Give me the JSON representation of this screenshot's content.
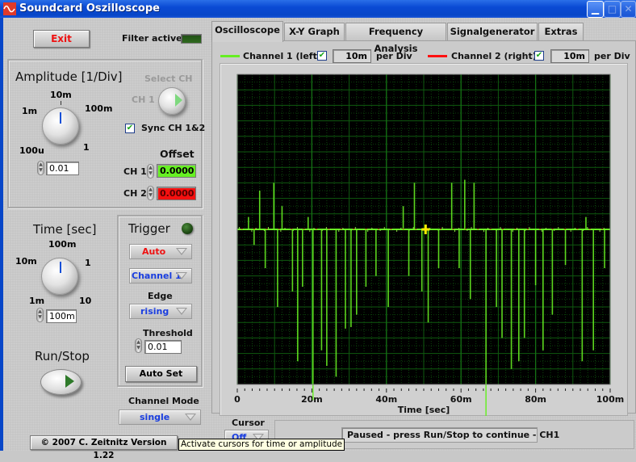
{
  "window": {
    "title": "Soundcard Oszilloscope",
    "controls": [
      "minimize",
      "maximize",
      "close"
    ]
  },
  "left_panel": {
    "exit_label": "Exit",
    "filter_label": "Filter active",
    "amplitude": {
      "title": "Amplitude [1/Div]",
      "ticks": [
        "100u",
        "1m",
        "10m",
        "100m",
        "1"
      ],
      "value": "0.01"
    },
    "select_ch": {
      "title": "Select CH",
      "value": "CH 1"
    },
    "sync_label": "Sync CH 1&2",
    "sync_checked": true,
    "offset": {
      "title": "Offset",
      "ch1_label": "CH 1",
      "ch1_value": "0.0000",
      "ch1_color": "#5cf02a",
      "ch2_label": "CH 2",
      "ch2_value": "0.0000",
      "ch2_color": "#f01010"
    },
    "time": {
      "title": "Time [sec]",
      "ticks": [
        "1m",
        "10m",
        "100m",
        "1",
        "10"
      ],
      "value": "100m"
    },
    "trigger": {
      "title": "Trigger",
      "mode": "Auto",
      "source": "Channel 1",
      "edge_label": "Edge",
      "edge": "rising",
      "threshold_label": "Threshold",
      "threshold_value": "0.01",
      "autoset_label": "Auto Set"
    },
    "run_stop_label": "Run/Stop",
    "channel_mode_label": "Channel Mode",
    "channel_mode": "single",
    "copyright": "© 2007   C. Zeitnitz Version 1.22"
  },
  "tabs": [
    {
      "label": "Oscilloscope",
      "active": true
    },
    {
      "label": "X-Y Graph",
      "active": false
    },
    {
      "label": "Frequency Analysis",
      "active": false
    },
    {
      "label": "Signalgenerator",
      "active": false
    },
    {
      "label": "Extras",
      "active": false
    }
  ],
  "channels": {
    "ch1_label": "Channel 1 (left)",
    "ch1_enabled": true,
    "ch1_per_div": "10m",
    "ch1_color": "#66ee22",
    "ch2_label": "Channel 2 (right)",
    "ch2_enabled": true,
    "ch2_per_div": "10m",
    "ch2_color": "#ff1010",
    "per_div_label": "per Div"
  },
  "cursor": {
    "label": "Cursor",
    "value": "Off"
  },
  "status": "Paused - press Run/Stop to continue - CH1",
  "tooltip": "Activate cursors for time or amplitude",
  "chart_data": {
    "type": "line",
    "title": "",
    "xlabel": "Time [sec]",
    "ylabel": "",
    "xlim": [
      0,
      0.1
    ],
    "ylim": [
      -0.1,
      0.1
    ],
    "xticks": [
      {
        "value": 0,
        "label": "0"
      },
      {
        "value": 0.02,
        "label": "20m"
      },
      {
        "value": 0.04,
        "label": "40m"
      },
      {
        "value": 0.06,
        "label": "60m"
      },
      {
        "value": 0.08,
        "label": "80m"
      },
      {
        "value": 0.1,
        "label": "100m"
      }
    ],
    "grid": true,
    "background": "#000000",
    "grid_color": "#0f5a0f",
    "cursor_marker": {
      "x": 0.0505,
      "y": 0.0
    },
    "series": [
      {
        "name": "Channel 1 (left)",
        "color": "#66ee22",
        "baseline": 0.0,
        "spikes": [
          {
            "x": 0.003,
            "y": 0.008
          },
          {
            "x": 0.0045,
            "y": -0.01
          },
          {
            "x": 0.006,
            "y": 0.025
          },
          {
            "x": 0.0075,
            "y": -0.025
          },
          {
            "x": 0.0098,
            "y": 0.03
          },
          {
            "x": 0.0108,
            "y": -0.05
          },
          {
            "x": 0.012,
            "y": 0.015
          },
          {
            "x": 0.0148,
            "y": -0.04
          },
          {
            "x": 0.0162,
            "y": -0.085
          },
          {
            "x": 0.0175,
            "y": -0.037
          },
          {
            "x": 0.019,
            "y": 0.008
          },
          {
            "x": 0.0203,
            "y": -0.11
          },
          {
            "x": 0.0226,
            "y": -0.078
          },
          {
            "x": 0.024,
            "y": -0.088
          },
          {
            "x": 0.0265,
            "y": -0.095
          },
          {
            "x": 0.029,
            "y": -0.064
          },
          {
            "x": 0.0305,
            "y": -0.063
          },
          {
            "x": 0.032,
            "y": -0.055
          },
          {
            "x": 0.0345,
            "y": -0.037
          },
          {
            "x": 0.0372,
            "y": -0.03
          },
          {
            "x": 0.0405,
            "y": -0.05
          },
          {
            "x": 0.0445,
            "y": 0.015
          },
          {
            "x": 0.046,
            "y": -0.03
          },
          {
            "x": 0.0475,
            "y": 0.03
          },
          {
            "x": 0.0495,
            "y": -0.04
          },
          {
            "x": 0.0512,
            "y": -0.06
          },
          {
            "x": 0.054,
            "y": -0.025
          },
          {
            "x": 0.0575,
            "y": 0.03
          },
          {
            "x": 0.0595,
            "y": -0.025
          },
          {
            "x": 0.061,
            "y": 0.032
          },
          {
            "x": 0.0625,
            "y": -0.045
          },
          {
            "x": 0.0635,
            "y": 0.03
          },
          {
            "x": 0.0667,
            "y": -0.136
          },
          {
            "x": 0.0695,
            "y": -0.05
          },
          {
            "x": 0.071,
            "y": -0.07
          },
          {
            "x": 0.0735,
            "y": -0.09
          },
          {
            "x": 0.0755,
            "y": -0.085
          },
          {
            "x": 0.077,
            "y": -0.07
          },
          {
            "x": 0.08,
            "y": -0.036
          },
          {
            "x": 0.082,
            "y": -0.078
          },
          {
            "x": 0.0845,
            "y": -0.055
          },
          {
            "x": 0.088,
            "y": -0.023
          },
          {
            "x": 0.0925,
            "y": -0.085
          },
          {
            "x": 0.0935,
            "y": 0.008
          },
          {
            "x": 0.0955,
            "y": -0.078
          },
          {
            "x": 0.0985,
            "y": -0.025
          }
        ]
      }
    ]
  }
}
